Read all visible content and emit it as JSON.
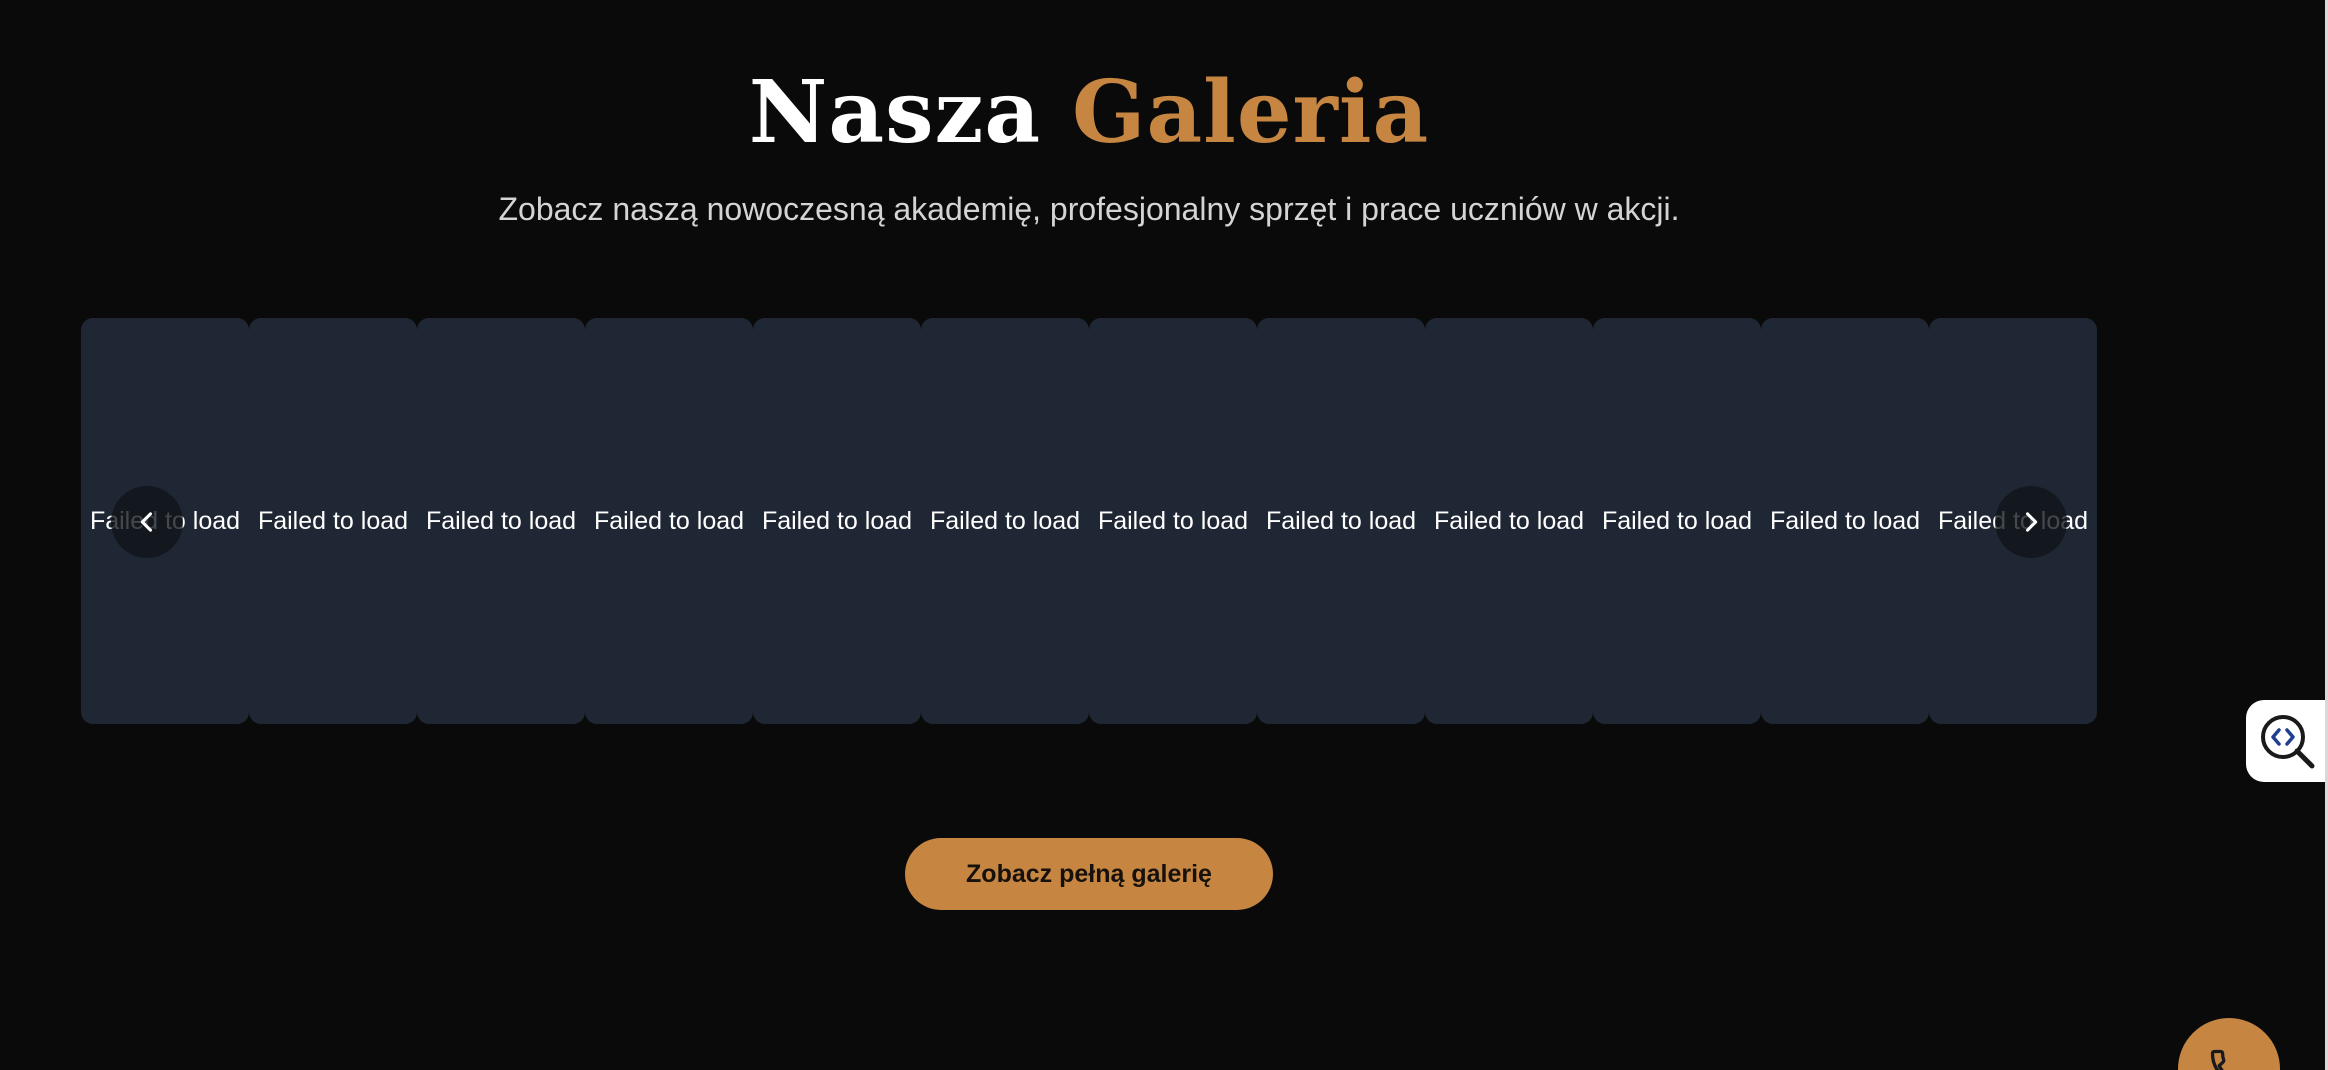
{
  "gallery": {
    "title_main": "Nasza",
    "title_accent": "Galeria",
    "subtitle": "Zobacz naszą nowoczesną akademię, profesjonalny sprzęt i prace uczniów w akcji.",
    "slides": [
      {
        "alt": "Failed to load"
      },
      {
        "alt": "Failed to load"
      },
      {
        "alt": "Failed to load"
      },
      {
        "alt": "Failed to load"
      },
      {
        "alt": "Failed to load"
      },
      {
        "alt": "Failed to load"
      },
      {
        "alt": "Failed to load"
      },
      {
        "alt": "Failed to load"
      },
      {
        "alt": "Failed to load"
      },
      {
        "alt": "Failed to load"
      },
      {
        "alt": "Failed to load"
      },
      {
        "alt": "Failed to load"
      }
    ],
    "prev_icon": "chevron-left-icon",
    "next_icon": "chevron-right-icon",
    "cta_label": "Zobacz pełną galerię"
  },
  "widgets": {
    "side_icon": "code-search-icon",
    "floating_icon": "phone-icon"
  },
  "colors": {
    "background": "#0a0a0a",
    "accent": "#c68642",
    "slide_background": "#202734",
    "text": "#ffffff",
    "subtitle": "#d4d4d4"
  }
}
